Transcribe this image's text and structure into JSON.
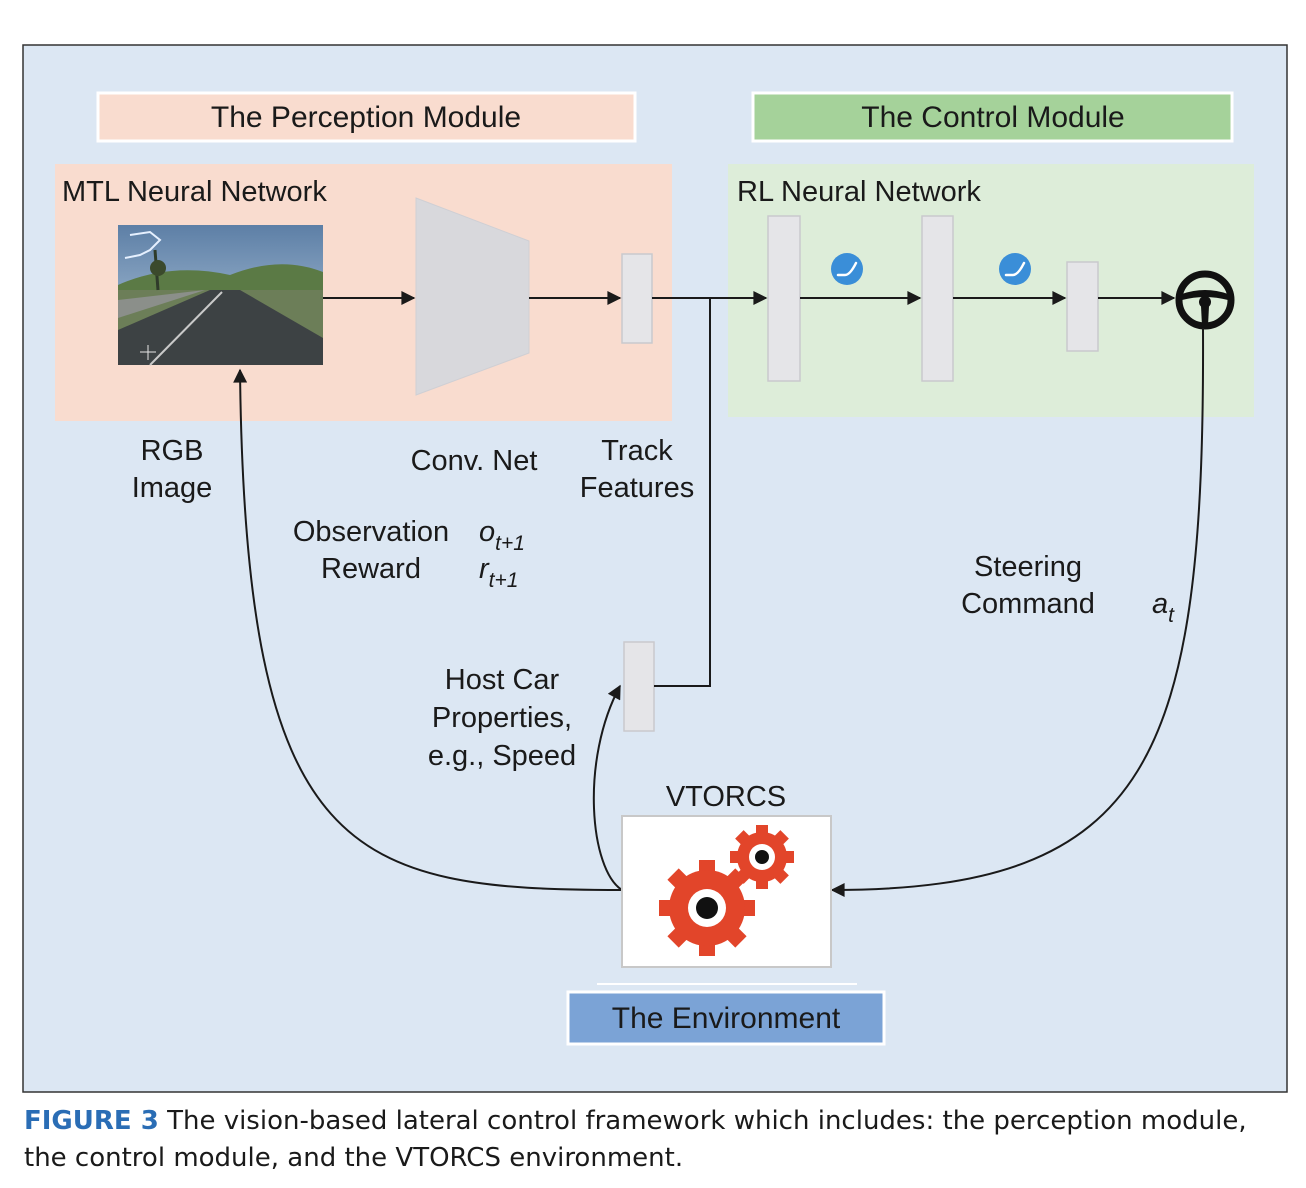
{
  "modules": {
    "perception": "The Perception Module",
    "control": "The Control Module",
    "environment": "The Environment"
  },
  "networks": {
    "mtl": "MTL Neural Network",
    "rl": "RL Neural Network"
  },
  "labels": {
    "rgb_line1": "RGB",
    "rgb_line2": "Image",
    "conv_net": "Conv. Net",
    "track_line1": "Track",
    "track_line2": "Features",
    "observation": "Observation",
    "reward": "Reward",
    "obs_symbol": "o",
    "reward_symbol": "r",
    "subscript_next": "t+1",
    "host_line1": "Host Car",
    "host_line2": "Properties,",
    "host_line3": "e.g., Speed",
    "steering_line1": "Steering",
    "steering_line2": "Command",
    "action_symbol": "a",
    "subscript_t": "t",
    "vtorcs": "VTORCS"
  },
  "caption": {
    "figure_number": "FIGURE 3",
    "text": " The vision-based lateral control framework which includes: the perception module, the control module, and the VTORCS environment."
  },
  "icons": {
    "road_image": "road-scene-image",
    "activation": "activation-function-icon",
    "steering": "steering-wheel-icon",
    "gears": "gears-icon"
  },
  "colors": {
    "background_panel": "#dce7f3",
    "perception": "#f9dccf",
    "control": "#ddedd9",
    "control_header": "#a5d29a",
    "environment_header": "#7ba3d6",
    "layer_block": "#e5e5e8",
    "activation": "#3a8ed8",
    "gear": "#e2452a",
    "caption_accent": "#2a6db5"
  }
}
